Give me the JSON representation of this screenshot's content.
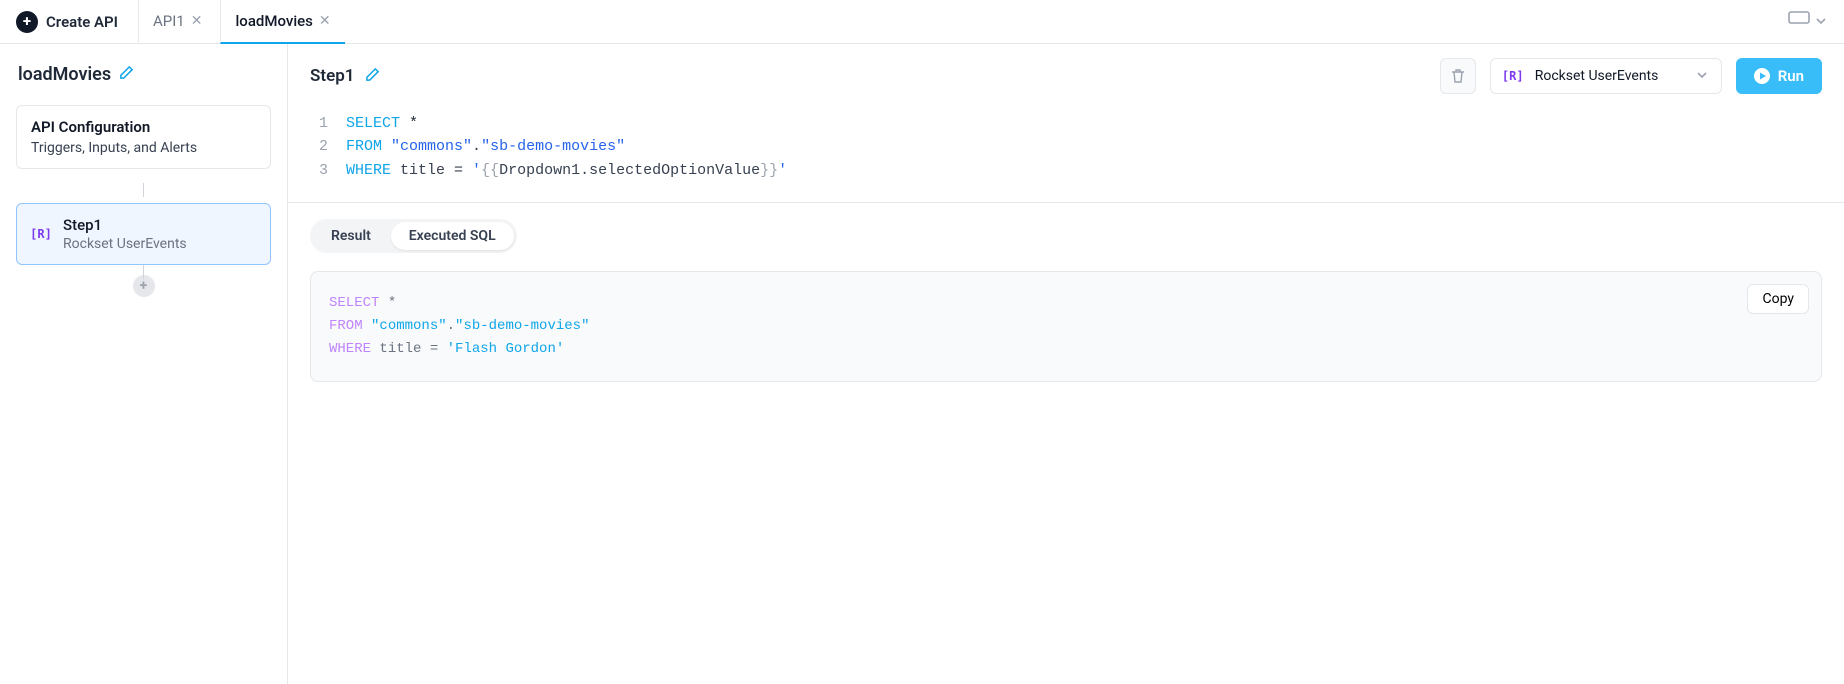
{
  "topbar": {
    "create_api_label": "Create API",
    "tabs": [
      {
        "label": "API1"
      },
      {
        "label": "loadMovies"
      }
    ]
  },
  "sidebar": {
    "api_name": "loadMovies",
    "config": {
      "title": "API Configuration",
      "subtitle": "Triggers, Inputs, and Alerts"
    },
    "step": {
      "name": "Step1",
      "datasource": "Rockset UserEvents"
    }
  },
  "main": {
    "step_title": "Step1",
    "datasource_label": "Rockset UserEvents",
    "run_label": "Run",
    "editor": {
      "lines": [
        {
          "no": "1",
          "kw": "SELECT",
          "rest": " *"
        },
        {
          "no": "2",
          "kw": "FROM",
          "str1": "\"commons\"",
          "dot": ".",
          "str2": "\"sb-demo-movies\""
        },
        {
          "no": "3",
          "kw": "WHERE",
          "col": " title = ",
          "q1": "'",
          "t1": "{{",
          "templ": "Dropdown1.selectedOptionValue",
          "t2": "}}",
          "q2": "'"
        }
      ]
    },
    "tabs": {
      "result": "Result",
      "executed": "Executed SQL"
    },
    "executed": {
      "line1_kw": "SELECT",
      "line1_rest": " *",
      "line2_kw": "FROM",
      "line2_str1": "\"commons\"",
      "line2_dot": ".",
      "line2_str2": "\"sb-demo-movies\"",
      "line3_kw": "WHERE",
      "line3_col": " title = ",
      "line3_val": "'Flash Gordon'"
    },
    "copy_label": "Copy"
  }
}
